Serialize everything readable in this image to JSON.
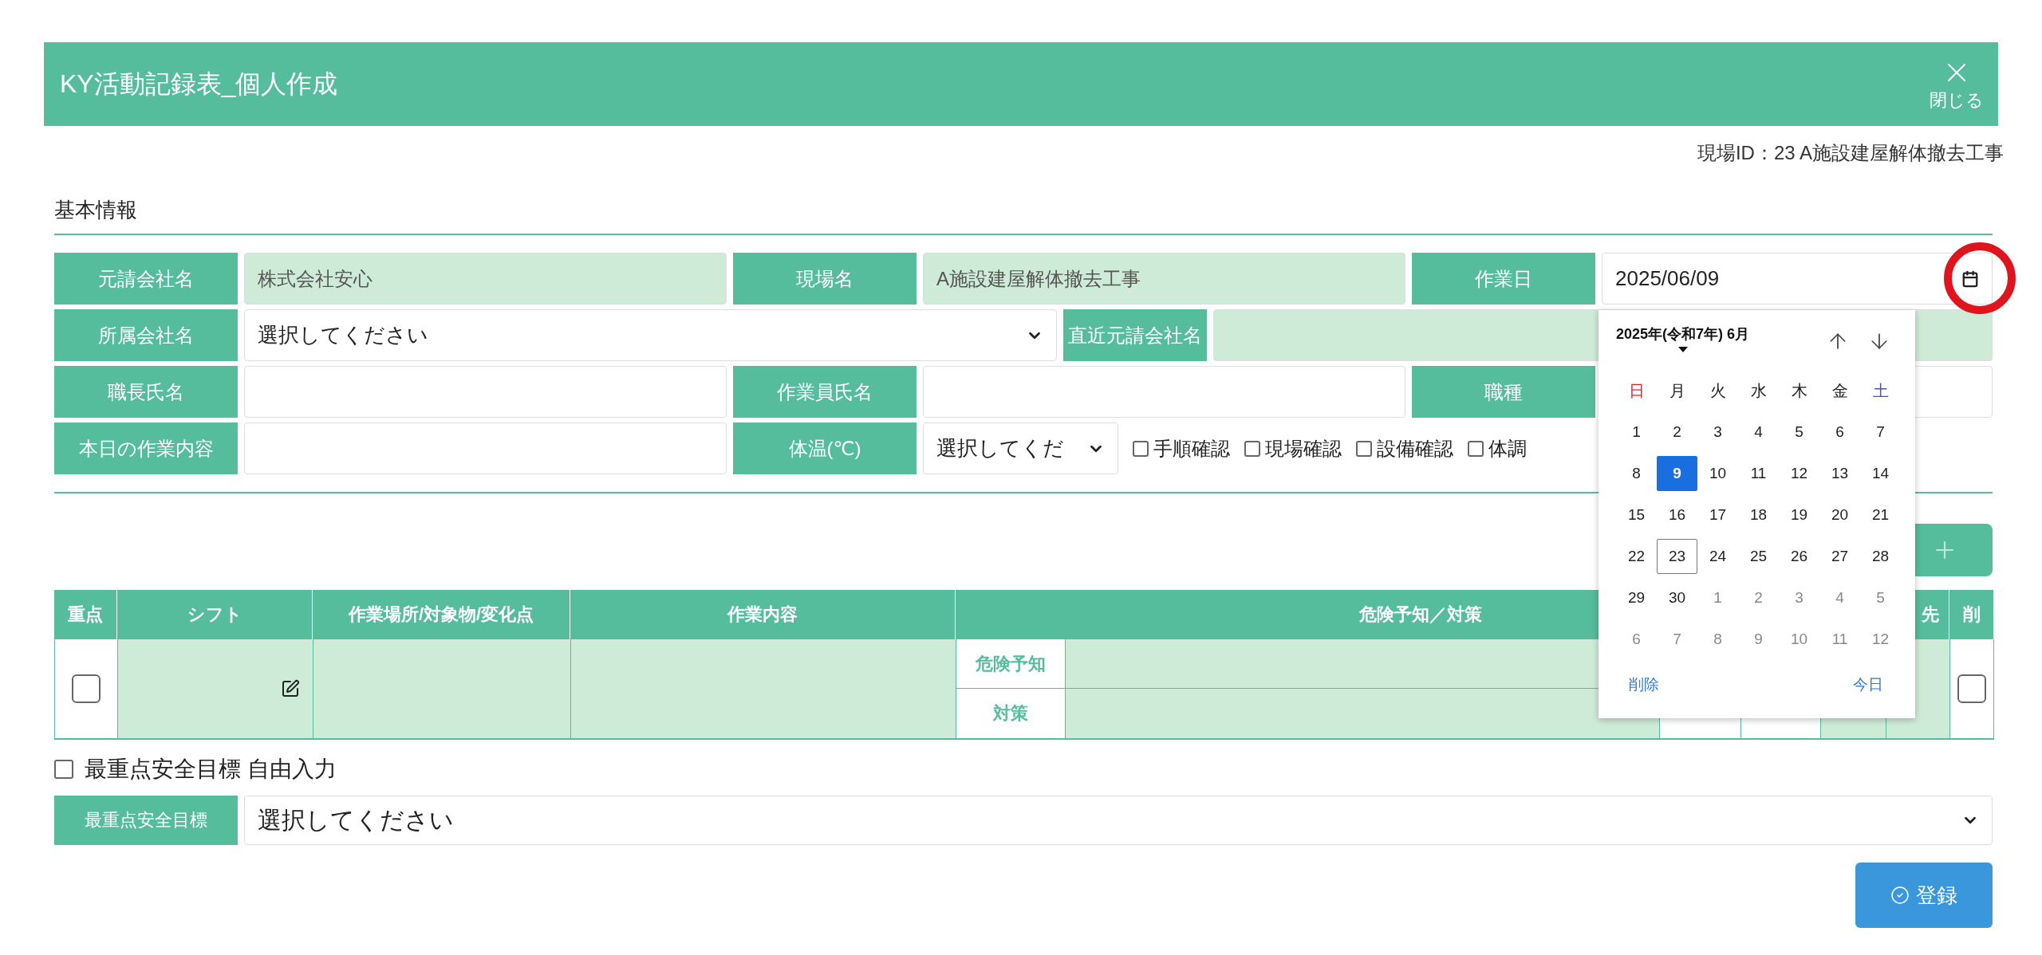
{
  "header": {
    "title": "KY活動記録表_個人作成",
    "close_label": "閉じる"
  },
  "site_id": "現場ID：23 A施設建屋解体撤去工事",
  "section_title": "基本情報",
  "form_rows": [
    [
      {
        "kind": "label",
        "text": "元請会社名"
      },
      {
        "kind": "readonly",
        "text": "株式会社安心"
      },
      {
        "kind": "label",
        "text": "現場名"
      },
      {
        "kind": "readonly",
        "text": "A施設建屋解体撤去工事"
      },
      {
        "kind": "label",
        "text": "作業日"
      },
      {
        "kind": "date",
        "text": "2025/06/09"
      }
    ],
    [
      {
        "kind": "label",
        "text": "所属会社名"
      },
      {
        "kind": "select",
        "text": "選択してください"
      },
      {
        "kind": "label_narrow",
        "text": "直近元請会社名"
      },
      {
        "kind": "readonly"
      }
    ],
    [
      {
        "kind": "label",
        "text": "職長氏名"
      },
      {
        "kind": "input"
      },
      {
        "kind": "label",
        "text": "作業員氏名"
      },
      {
        "kind": "input"
      },
      {
        "kind": "label",
        "text": "職種"
      },
      {
        "kind": "input"
      }
    ],
    [
      {
        "kind": "label",
        "text": "本日の作業内容"
      },
      {
        "kind": "input"
      },
      {
        "kind": "label",
        "text": "体温(℃)"
      },
      {
        "kind": "select_narrow",
        "text": "選択してくだ"
      },
      {
        "kind": "checkbox",
        "text": "手順確認",
        "checked": false
      },
      {
        "kind": "checkbox",
        "text": "現場確認",
        "checked": false
      },
      {
        "kind": "checkbox",
        "text": "設備確認",
        "checked": false
      },
      {
        "kind": "checkbox",
        "text": "体調",
        "checked": false
      }
    ]
  ],
  "calendar": {
    "title": "2025年(令和7年) 6月",
    "weekdays": [
      {
        "label": "日",
        "color": "#e02424"
      },
      {
        "label": "月",
        "color": "#222222"
      },
      {
        "label": "火",
        "color": "#222222"
      },
      {
        "label": "水",
        "color": "#222222"
      },
      {
        "label": "木",
        "color": "#222222"
      },
      {
        "label": "金",
        "color": "#222222"
      },
      {
        "label": "土",
        "color": "#4a4ae8"
      }
    ],
    "days": [
      {
        "label": "1",
        "kind": "current",
        "selected": false,
        "today": false
      },
      {
        "label": "2",
        "kind": "current",
        "selected": false,
        "today": false
      },
      {
        "label": "3",
        "kind": "current",
        "selected": false,
        "today": false
      },
      {
        "label": "4",
        "kind": "current",
        "selected": false,
        "today": false
      },
      {
        "label": "5",
        "kind": "current",
        "selected": false,
        "today": false
      },
      {
        "label": "6",
        "kind": "current",
        "selected": false,
        "today": false
      },
      {
        "label": "7",
        "kind": "current",
        "selected": false,
        "today": false
      },
      {
        "label": "8",
        "kind": "current",
        "selected": false,
        "today": false
      },
      {
        "label": "9",
        "kind": "current",
        "selected": true,
        "today": false
      },
      {
        "label": "10",
        "kind": "current",
        "selected": false,
        "today": false
      },
      {
        "label": "11",
        "kind": "current",
        "selected": false,
        "today": false
      },
      {
        "label": "12",
        "kind": "current",
        "selected": false,
        "today": false
      },
      {
        "label": "13",
        "kind": "current",
        "selected": false,
        "today": false
      },
      {
        "label": "14",
        "kind": "current",
        "selected": false,
        "today": false
      },
      {
        "label": "15",
        "kind": "current",
        "selected": false,
        "today": false
      },
      {
        "label": "16",
        "kind": "current",
        "selected": false,
        "today": false
      },
      {
        "label": "17",
        "kind": "current",
        "selected": false,
        "today": false
      },
      {
        "label": "18",
        "kind": "current",
        "selected": false,
        "today": false
      },
      {
        "label": "19",
        "kind": "current",
        "selected": false,
        "today": false
      },
      {
        "label": "20",
        "kind": "current",
        "selected": false,
        "today": false
      },
      {
        "label": "21",
        "kind": "current",
        "selected": false,
        "today": false
      },
      {
        "label": "22",
        "kind": "current",
        "selected": false,
        "today": false
      },
      {
        "label": "23",
        "kind": "current",
        "selected": false,
        "today": true
      },
      {
        "label": "24",
        "kind": "current",
        "selected": false,
        "today": false
      },
      {
        "label": "25",
        "kind": "current",
        "selected": false,
        "today": false
      },
      {
        "label": "26",
        "kind": "current",
        "selected": false,
        "today": false
      },
      {
        "label": "27",
        "kind": "current",
        "selected": false,
        "today": false
      },
      {
        "label": "28",
        "kind": "current",
        "selected": false,
        "today": false
      },
      {
        "label": "29",
        "kind": "current",
        "selected": false,
        "today": false
      },
      {
        "label": "30",
        "kind": "current",
        "selected": false,
        "today": false
      },
      {
        "label": "1",
        "kind": "other",
        "selected": false,
        "today": false
      },
      {
        "label": "2",
        "kind": "other",
        "selected": false,
        "today": false
      },
      {
        "label": "3",
        "kind": "other",
        "selected": false,
        "today": false
      },
      {
        "label": "4",
        "kind": "other",
        "selected": false,
        "today": false
      },
      {
        "label": "5",
        "kind": "other",
        "selected": false,
        "today": false
      },
      {
        "label": "6",
        "kind": "other",
        "selected": false,
        "today": false
      },
      {
        "label": "7",
        "kind": "other",
        "selected": false,
        "today": false
      },
      {
        "label": "8",
        "kind": "other",
        "selected": false,
        "today": false
      },
      {
        "label": "9",
        "kind": "other",
        "selected": false,
        "today": false
      },
      {
        "label": "10",
        "kind": "other",
        "selected": false,
        "today": false
      },
      {
        "label": "11",
        "kind": "other",
        "selected": false,
        "today": false
      },
      {
        "label": "12",
        "kind": "other",
        "selected": false,
        "today": false
      }
    ],
    "clear_label": "削除",
    "today_label": "今日"
  },
  "table": {
    "columns": [
      {
        "label": "重点"
      },
      {
        "label": "シフト"
      },
      {
        "label": "作業場所/対象物/変化点"
      },
      {
        "label": "作業内容"
      },
      {
        "label": "危険予知／対策"
      },
      {
        "label": "先"
      },
      {
        "label": "削"
      }
    ],
    "rows": [
      {
        "priority_checked": false,
        "hazard_label": "危険予知",
        "measure_label": "対策",
        "delete_checked": false
      }
    ]
  },
  "free_input": {
    "label": "最重点安全目標 自由入力",
    "checked": false
  },
  "goal": {
    "label": "最重点安全目標",
    "value": "選択してください"
  },
  "submit_label": "登録"
}
